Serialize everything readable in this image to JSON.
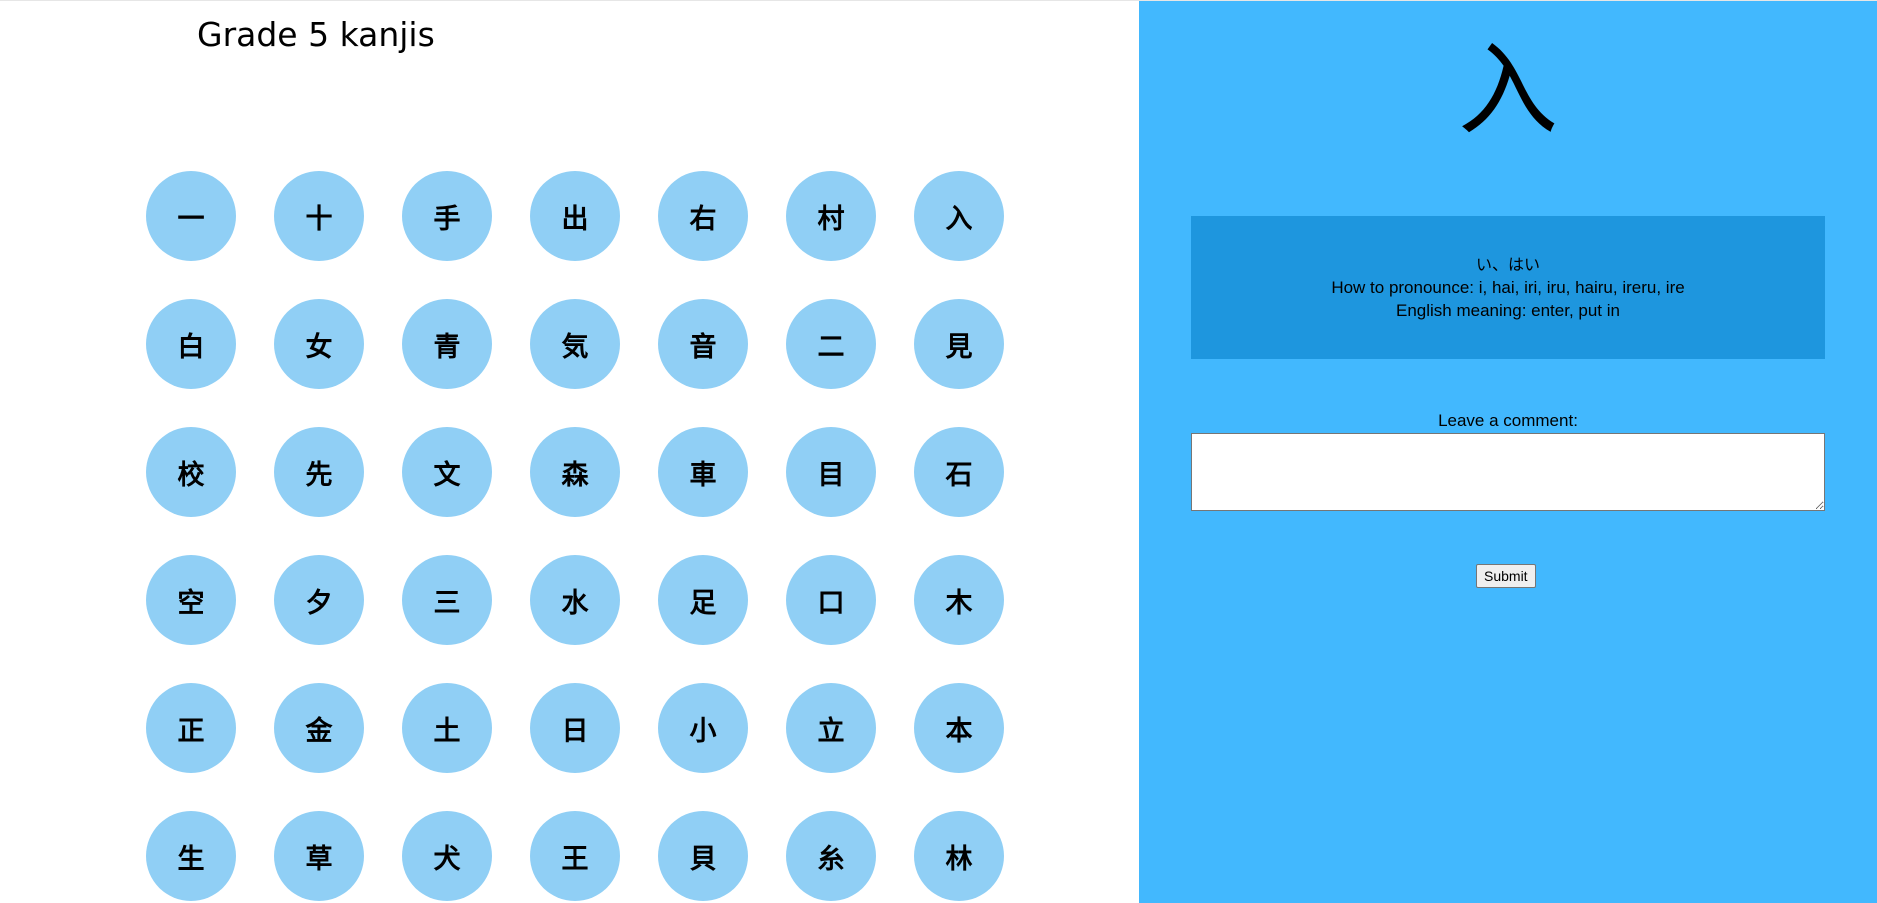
{
  "left_panel": {
    "title": "Grade 5 kanjis",
    "kanji_grid": [
      "一",
      "十",
      "手",
      "出",
      "右",
      "村",
      "入",
      "白",
      "女",
      "青",
      "気",
      "音",
      "二",
      "見",
      "校",
      "先",
      "文",
      "森",
      "車",
      "目",
      "石",
      "空",
      "夕",
      "三",
      "水",
      "足",
      "口",
      "木",
      "正",
      "金",
      "土",
      "日",
      "小",
      "立",
      "本",
      "生",
      "草",
      "犬",
      "王",
      "貝",
      "糸",
      "林"
    ]
  },
  "detail_panel": {
    "selected_kanji": "入",
    "reading": "い、はい",
    "pronounce": "How to pronounce: i, hai, iri, iru, hairu, ireru, ire",
    "meaning": "English meaning: enter, put in",
    "comment_label": "Leave a comment:",
    "comment_value": "",
    "submit_label": "Submit"
  },
  "colors": {
    "kanji_button_bg": "#90cff5",
    "panel_bg": "#42b8fe",
    "info_box_bg": "#1e96de"
  }
}
